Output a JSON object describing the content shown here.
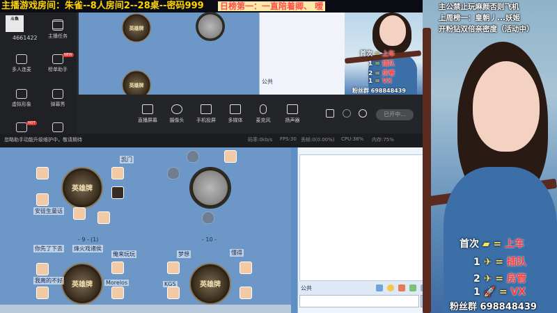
{
  "banner": {
    "text": "主播游戏房间：朱雀--8人房间2--28桌--密码999",
    "highlight": "日榜第一：一直陪着卿、 嗳"
  },
  "streamer_panel": {
    "logo_text": "斗鱼",
    "user_id": "4661422",
    "sidebar": [
      {
        "label": "",
        "icon": "home-icon"
      },
      {
        "label": "主播任务",
        "icon": "task-icon"
      },
      {
        "label": "多人连麦",
        "icon": "multi-link-icon"
      },
      {
        "label": "榜单助手",
        "icon": "rank-helper-icon",
        "badge": "NEW"
      },
      {
        "label": "虚拟形象",
        "icon": "avatar-icon"
      },
      {
        "label": "弹幕秀",
        "icon": "danmu-icon"
      },
      {
        "label": "",
        "icon": "gift-icon",
        "badge": "HOT"
      },
      {
        "label": "",
        "icon": "fire-icon"
      }
    ],
    "tools": [
      {
        "label": "直播屏幕",
        "icon": "screen-icon"
      },
      {
        "label": "摄像头",
        "icon": "camera-icon"
      },
      {
        "label": "手机投屏",
        "icon": "phone-cast-icon"
      },
      {
        "label": "多媒体",
        "icon": "media-icon"
      },
      {
        "label": "麦克风",
        "icon": "mic-icon"
      },
      {
        "label": "扬声器",
        "icon": "speaker-icon"
      }
    ],
    "start_button": "已开中...",
    "status_notice": "忽略助手动能升级维护中，敬请期待",
    "stats": [
      "码率:0kb/s",
      "FPS:30",
      "丢帧:0(0.00%)",
      "CPU:38%",
      "内存:75%"
    ]
  },
  "board": {
    "tables": [
      {
        "name": "英雄牌"
      },
      {
        "name": "英雄牌"
      },
      {
        "name": "英雄牌"
      },
      {
        "name": "英雄牌"
      },
      {
        "name": "英雄牌"
      }
    ],
    "table_numbers": [
      "- 9 -",
      "(1)",
      "- 10 -"
    ],
    "players": [
      "安徒生童话",
      "凯门",
      "你先了下去",
      "烽火戏诸侯",
      "俺来玩玩",
      "懂得",
      "我离的不好",
      "Morelos",
      "梦想",
      "KGS"
    ]
  },
  "chat": {
    "channel_label": "公共"
  },
  "overlay": {
    "notice_lines": [
      "主公禁止玩麻颜否则飞机",
      "上周榜一：皇朝丿...妖姬",
      "开粉钻双倍亲密度（活动中）"
    ],
    "ranks": [
      {
        "pos": "首次",
        "val": "上车"
      },
      {
        "pos": "1",
        "val": "插队"
      },
      {
        "pos": "2",
        "val": "房管"
      },
      {
        "pos": "1",
        "val": "VX"
      }
    ],
    "fan_qq": "粉丝群 698848439"
  }
}
